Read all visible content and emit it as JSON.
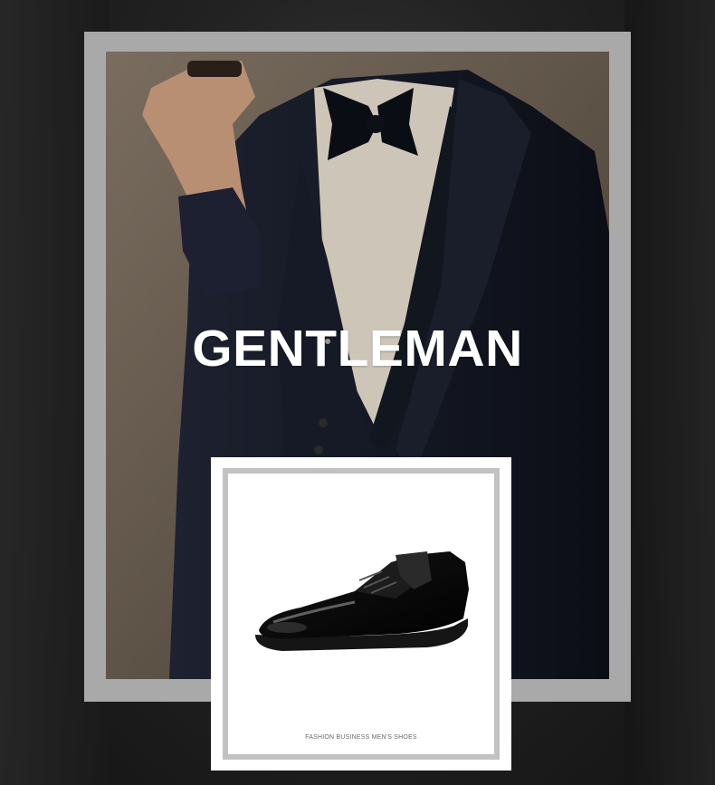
{
  "headline": "GENTLEMAN",
  "product_caption": "FASHION BUSINESS MEN'S SHOES",
  "colors": {
    "frame": "#a9a9a9",
    "card_border": "#c2c2c2",
    "headline": "#ffffff"
  },
  "images": {
    "hero": "man-in-tuxedo-photo",
    "product": "black-leather-derby-shoe"
  }
}
